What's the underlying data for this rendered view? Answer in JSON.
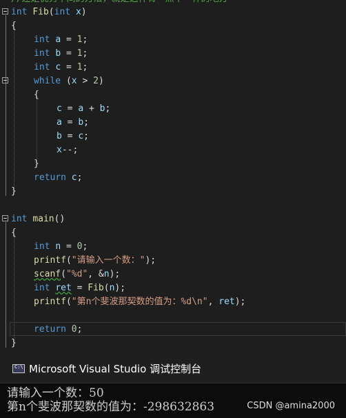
{
  "editor": {
    "comment_line": "//还是优秀中间的方法，就是这样有一点不一样的地方",
    "lines": {
      "l1": {
        "kw": "int",
        "fn": "Fib",
        "open": "(",
        "kw2": "int",
        "var": "x",
        "close": ")"
      },
      "l2": {
        "text": "{"
      },
      "l3": {
        "kw": "int",
        "var": "a",
        "op": " = ",
        "num": "1",
        "end": ";"
      },
      "l4": {
        "kw": "int",
        "var": "b",
        "op": " = ",
        "num": "1",
        "end": ";"
      },
      "l5": {
        "kw": "int",
        "var": "c",
        "op": " = ",
        "num": "1",
        "end": ";"
      },
      "l6": {
        "kw": "while",
        "open": " (",
        "var": "x",
        "op": " > ",
        "num": "2",
        "close": ")"
      },
      "l7": {
        "text": "{"
      },
      "l8": {
        "v1": "c",
        "op1": " = ",
        "v2": "a",
        "op2": " + ",
        "v3": "b",
        "end": ";"
      },
      "l9": {
        "v1": "a",
        "op1": " = ",
        "v2": "b",
        "end": ";"
      },
      "l10": {
        "v1": "b",
        "op1": " = ",
        "v2": "c",
        "end": ";"
      },
      "l11": {
        "v1": "x",
        "op": "--",
        "end": ";"
      },
      "l12": {
        "text": "}"
      },
      "l13": {
        "kw": "return",
        "sp": " ",
        "var": "c",
        "end": ";"
      },
      "l14": {
        "text": "}"
      },
      "l15": {
        "kw": "int",
        "fn": "main",
        "paren": "()"
      },
      "l16": {
        "text": "{"
      },
      "l17": {
        "kw": "int",
        "var": "n",
        "op": " = ",
        "num": "0",
        "end": ";"
      },
      "l18": {
        "fn": "printf",
        "open": "(",
        "str": "\"请输入一个数：\"",
        "close": ");"
      },
      "l19": {
        "fn": "scanf",
        "open": "(",
        "str": "\"%d\"",
        "mid": ", &",
        "var": "n",
        "close": ");"
      },
      "l20": {
        "kw": "int",
        "var": "ret",
        "op": " = ",
        "fn": "Fib",
        "open": "(",
        "var2": "n",
        "close": ");"
      },
      "l21": {
        "fn": "printf",
        "open": "(",
        "str": "\"第n个斐波那契数的值为：%d\\n\"",
        "mid": ", ",
        "var": "ret",
        "close": ");"
      },
      "l22": {
        "kw": "return",
        "sp": " ",
        "num": "0",
        "end": ";"
      },
      "l23": {
        "text": "}"
      }
    }
  },
  "console": {
    "title": "Microsoft Visual Studio 调试控制台",
    "output_line1": "请输入一个数：50",
    "output_line2": "第n个斐波那契数的值为：-298632863"
  },
  "watermark": "CSDN @amina2000",
  "colors": {
    "keyword": "#569cd6",
    "function": "#dcdcaa",
    "variable": "#9cdcfe",
    "string": "#d69d85",
    "number": "#b5cea8",
    "comment": "#57a64a",
    "editor_bg": "#1e1e1e",
    "console_bg": "#0c0c0c"
  }
}
